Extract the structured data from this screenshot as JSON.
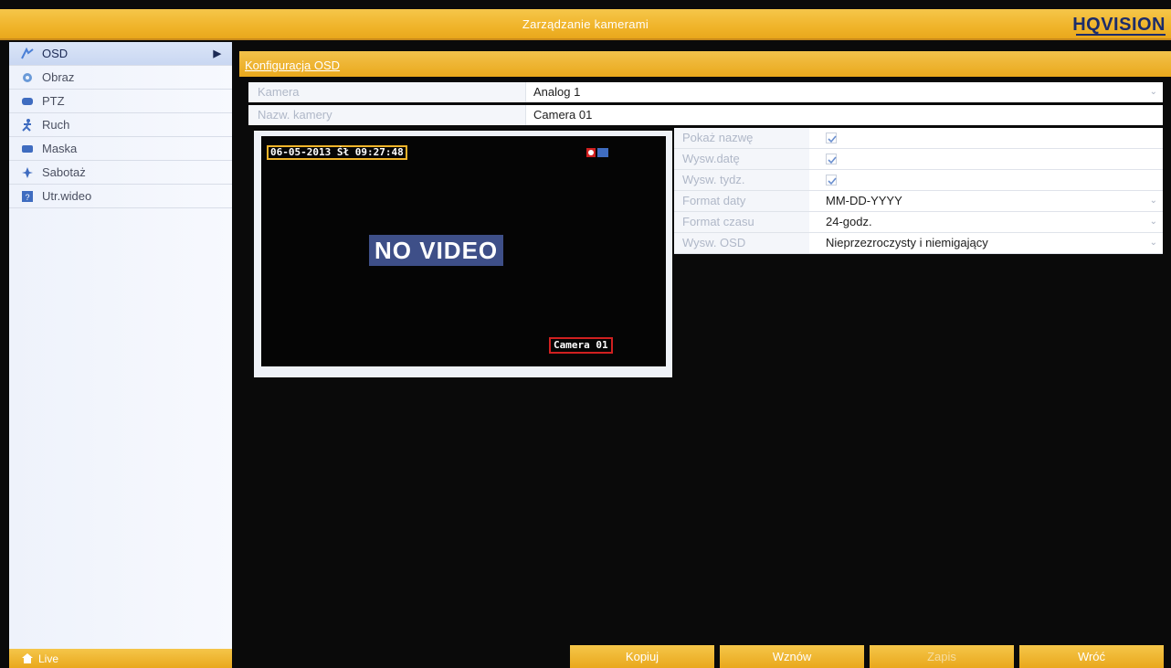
{
  "window": {
    "title": "Zarządzanie kamerami",
    "brand": "HQVISION"
  },
  "sidebar": {
    "items": [
      {
        "label": "OSD",
        "icon": "osd-icon",
        "active": true
      },
      {
        "label": "Obraz",
        "icon": "image-icon",
        "active": false
      },
      {
        "label": "PTZ",
        "icon": "ptz-icon",
        "active": false
      },
      {
        "label": "Ruch",
        "icon": "motion-icon",
        "active": false
      },
      {
        "label": "Maska",
        "icon": "mask-icon",
        "active": false
      },
      {
        "label": "Sabotaż",
        "icon": "tamper-icon",
        "active": false
      },
      {
        "label": "Utr.wideo",
        "icon": "video-loss-icon",
        "active": false
      }
    ],
    "live_label": "Live"
  },
  "section": {
    "title": "Konfiguracja OSD"
  },
  "camera_row": {
    "label": "Kamera",
    "value": "Analog 1"
  },
  "camera_name_row": {
    "label": "Nazw. kamery",
    "value": "Camera 01"
  },
  "preview": {
    "timestamp": "06-05-2013 Śł 09:27:48",
    "no_video": "NO VIDEO",
    "camera_label": "Camera 01"
  },
  "options": {
    "show_name": {
      "label": "Pokaż nazwę",
      "checked": true
    },
    "show_date": {
      "label": "Wysw.datę",
      "checked": true
    },
    "show_week": {
      "label": "Wysw. tydz.",
      "checked": true
    },
    "date_format": {
      "label": "Format daty",
      "value": "MM-DD-YYYY"
    },
    "time_format": {
      "label": "Format czasu",
      "value": "24-godz."
    },
    "osd_mode": {
      "label": "Wysw. OSD",
      "value": "Nieprzezroczysty i niemigający"
    }
  },
  "buttons": {
    "copy": "Kopiuj",
    "restore": "Wznów",
    "apply": "Zapis",
    "back": "Wróć"
  },
  "colors": {
    "accent": "#f0b42a",
    "sidebar_bg": "#eef2fb",
    "video_bg": "#050505",
    "novideo_bg": "#3e4f88",
    "brand": "#1c2c6a"
  }
}
